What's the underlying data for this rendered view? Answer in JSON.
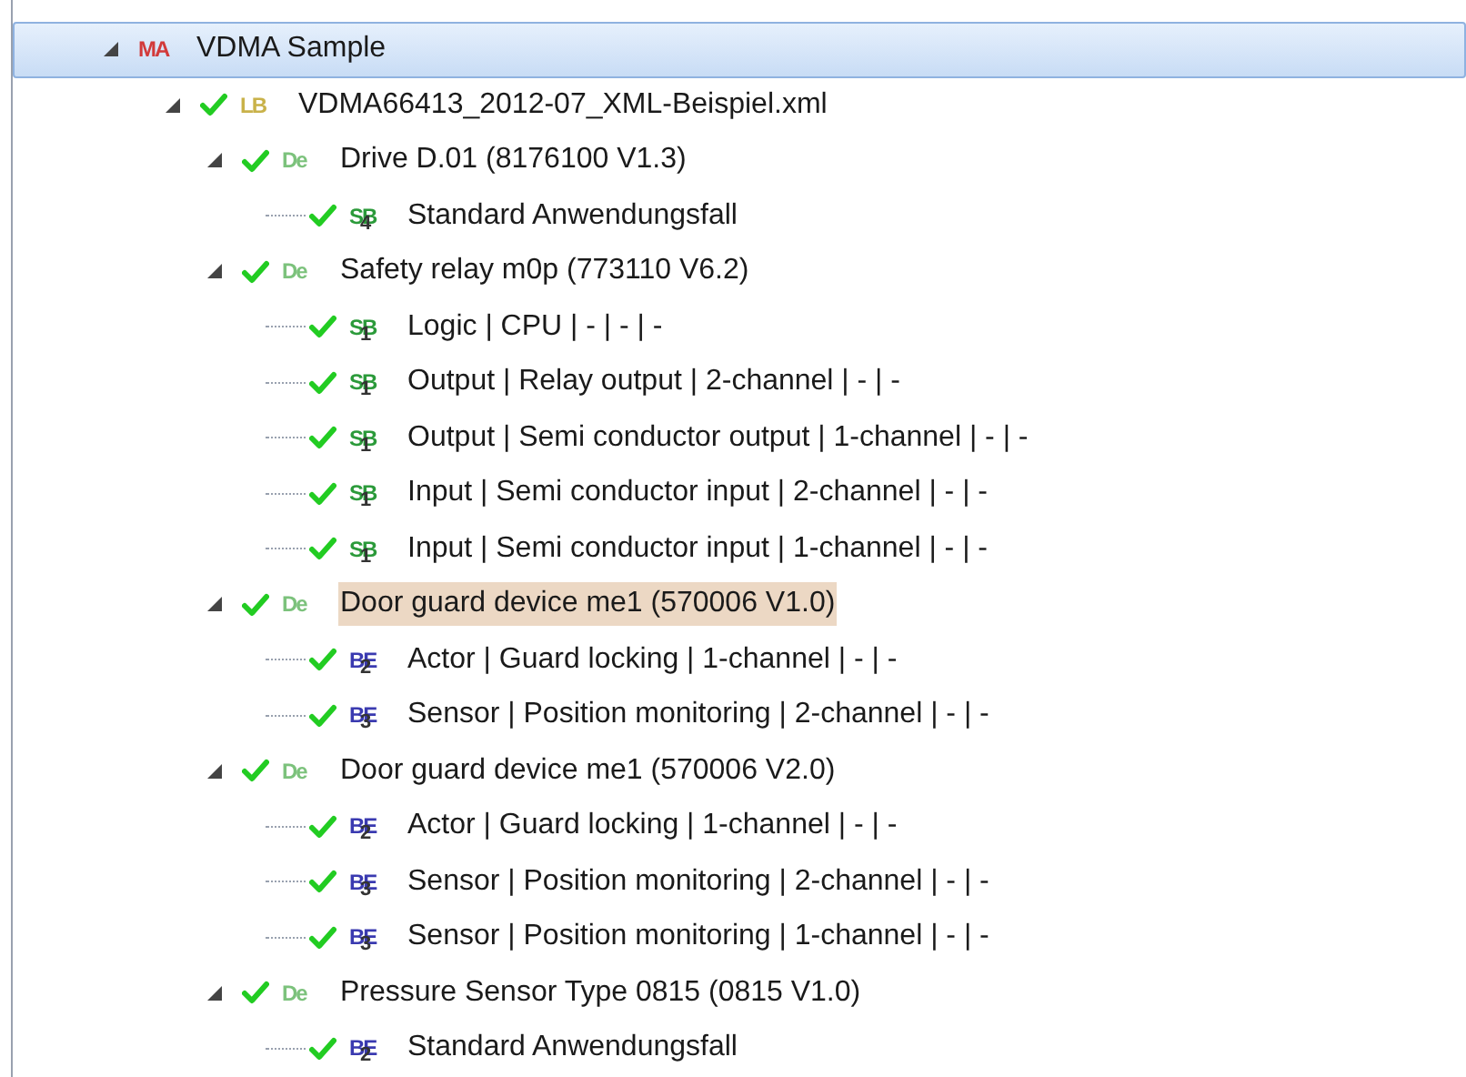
{
  "tree": [
    {
      "label": "VDMA Sample",
      "kind": "machine",
      "badge": "MA",
      "selected": true,
      "expanded": true,
      "children": [
        {
          "label": "VDMA66413_2012-07_XML-Beispiel.xml",
          "kind": "library",
          "badge": "LB",
          "checked": true,
          "expanded": true,
          "children": [
            {
              "label": "Drive D.01 (8176100 V1.3)",
              "kind": "device",
              "badge": "De",
              "checked": true,
              "expanded": true,
              "children": [
                {
                  "label": "Standard Anwendungsfall",
                  "kind": "safety",
                  "badge": "SB",
                  "badge_sub": "4",
                  "checked": true
                }
              ]
            },
            {
              "label": "Safety relay m0p (773110 V6.2)",
              "kind": "device",
              "badge": "De",
              "checked": true,
              "expanded": true,
              "children": [
                {
                  "label": "Logic | CPU | - | - | -",
                  "kind": "safety",
                  "badge": "SB",
                  "badge_sub": "1",
                  "checked": true
                },
                {
                  "label": "Output | Relay output | 2-channel | - | -",
                  "kind": "safety",
                  "badge": "SB",
                  "badge_sub": "1",
                  "checked": true
                },
                {
                  "label": "Output | Semi conductor output | 1-channel | - | -",
                  "kind": "safety",
                  "badge": "SB",
                  "badge_sub": "1",
                  "checked": true
                },
                {
                  "label": "Input | Semi conductor input | 2-channel | - | -",
                  "kind": "safety",
                  "badge": "SB",
                  "badge_sub": "1",
                  "checked": true
                },
                {
                  "label": "Input | Semi conductor input | 1-channel | - | -",
                  "kind": "safety",
                  "badge": "SB",
                  "badge_sub": "1",
                  "checked": true
                }
              ]
            },
            {
              "label": "Door guard device me1 (570006 V1.0)",
              "kind": "device",
              "badge": "De",
              "checked": true,
              "expanded": true,
              "highlighted": true,
              "children": [
                {
                  "label": "Actor | Guard locking | 1-channel | - | -",
                  "kind": "function",
                  "badge": "BE",
                  "badge_sub": "2",
                  "checked": true
                },
                {
                  "label": "Sensor | Position monitoring | 2-channel | - | -",
                  "kind": "function",
                  "badge": "BE",
                  "badge_sub": "3",
                  "checked": true
                }
              ]
            },
            {
              "label": "Door guard device me1 (570006 V2.0)",
              "kind": "device",
              "badge": "De",
              "checked": true,
              "expanded": true,
              "children": [
                {
                  "label": "Actor | Guard locking | 1-channel | - | -",
                  "kind": "function",
                  "badge": "BE",
                  "badge_sub": "2",
                  "checked": true
                },
                {
                  "label": "Sensor | Position monitoring | 2-channel | - | -",
                  "kind": "function",
                  "badge": "BE",
                  "badge_sub": "3",
                  "checked": true
                },
                {
                  "label": "Sensor | Position monitoring | 1-channel | - | -",
                  "kind": "function",
                  "badge": "BE",
                  "badge_sub": "3",
                  "checked": true
                }
              ]
            },
            {
              "label": "Pressure Sensor Type 0815 (0815 V1.0)",
              "kind": "device",
              "badge": "De",
              "checked": true,
              "expanded": true,
              "children": [
                {
                  "label": "Standard Anwendungsfall",
                  "kind": "function",
                  "badge": "BE",
                  "badge_sub": "2",
                  "checked": true
                }
              ]
            }
          ]
        }
      ]
    }
  ]
}
